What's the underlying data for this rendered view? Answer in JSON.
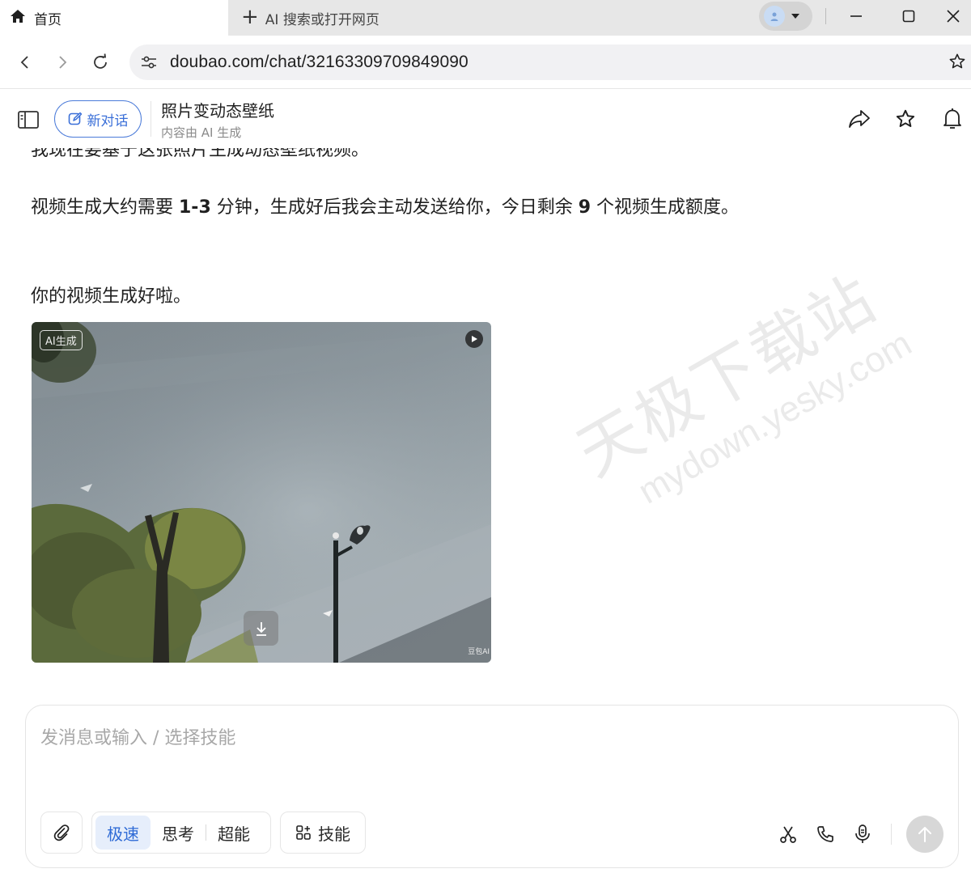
{
  "browser": {
    "active_tab_title": "首页",
    "new_tab_label": "AI 搜索或打开网页",
    "url": "doubao.com/chat/32163309709849090"
  },
  "header": {
    "new_chat_label": "新对话",
    "title": "照片变动态壁纸",
    "subtitle": "内容由 AI 生成"
  },
  "chat": {
    "partial_line": "我现在要基于这张照片生成动态壁纸视频。",
    "line1_a": "视频生成大约需要 ",
    "line1_b": "1-3",
    "line1_c": " 分钟，生成好后我会主动发送给你，今日剩余 ",
    "line1_d": "9",
    "line1_e": " 个视频生成额度。",
    "done_message": "你的视频生成好啦。",
    "video": {
      "ai_badge": "AI生成",
      "corner_mark": "豆包AI"
    }
  },
  "watermark": {
    "cn": "天极下载站",
    "en": "mydown.yesky.com"
  },
  "composer": {
    "placeholder": "发消息或输入 / 选择技能",
    "modes": [
      "极速",
      "思考",
      "超能"
    ],
    "active_mode": "极速",
    "skills_label": "技能"
  },
  "colors": {
    "accent": "#3a6fd8",
    "active_mode_bg": "#e6eefb",
    "send_disabled": "#d7d7d7"
  }
}
